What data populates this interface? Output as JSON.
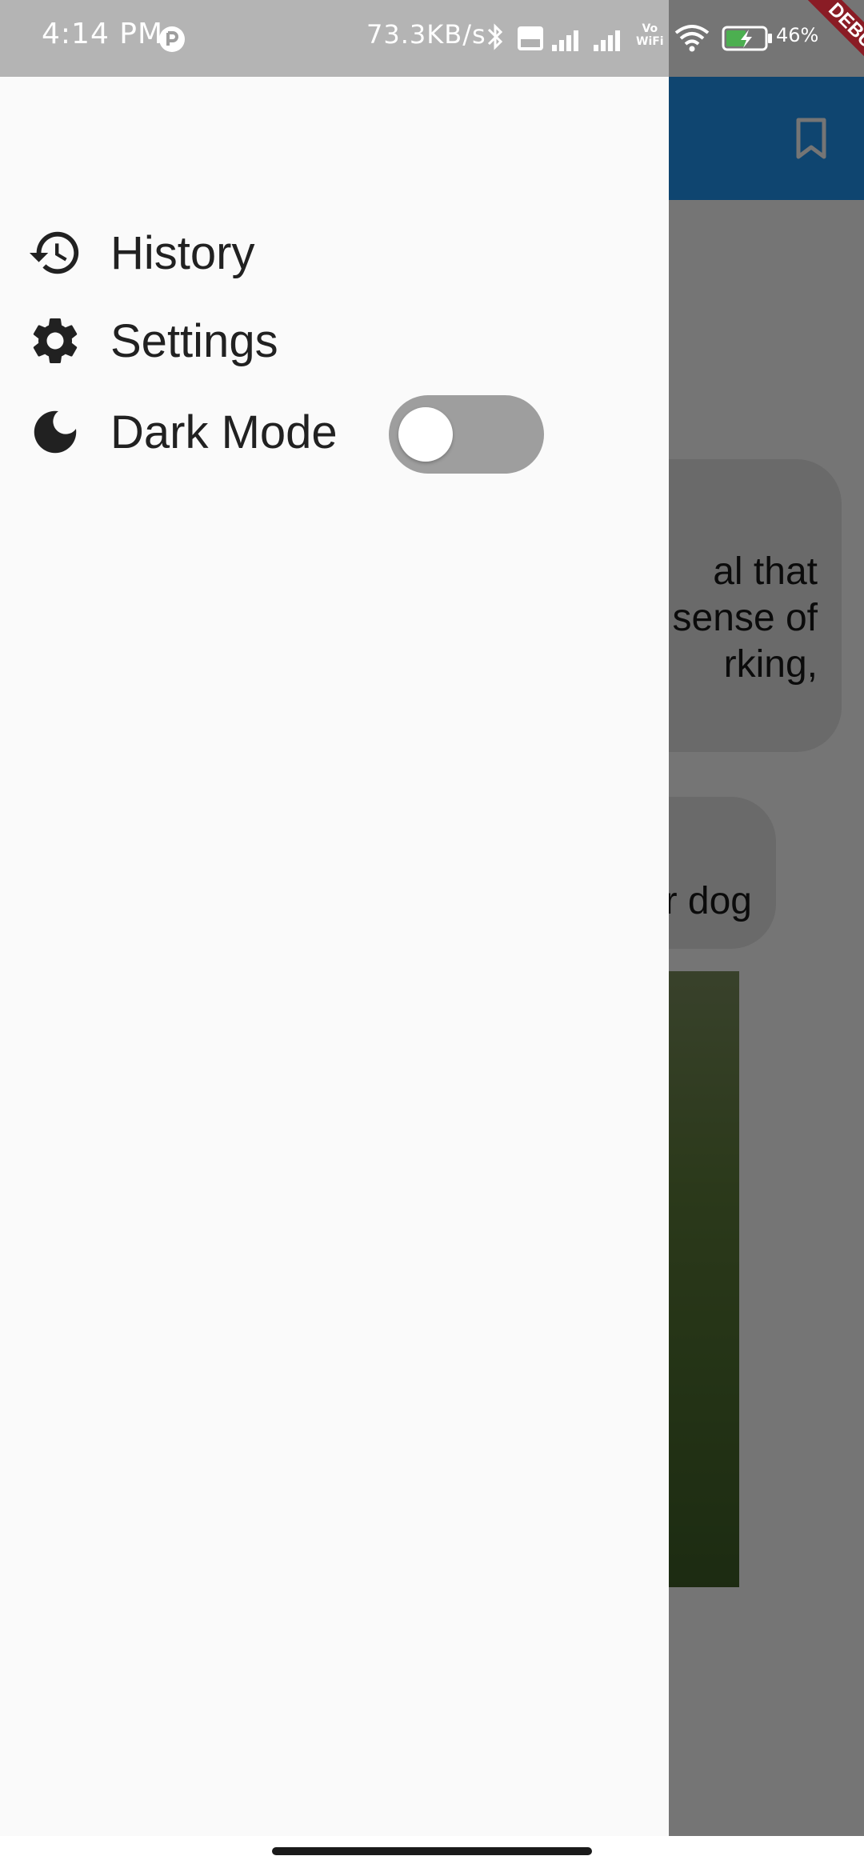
{
  "status_bar": {
    "time": "4:14 PM",
    "network_speed": "73.3KB/s",
    "vo_wifi_line1": "Vo",
    "vo_wifi_line2": "WiFi",
    "battery_percent": "46%",
    "icons": [
      "app-notification-icon",
      "bluetooth-icon",
      "volte-icon",
      "signal-icon",
      "signal-icon",
      "vowifi-icon",
      "wifi-icon",
      "battery-charging-icon"
    ]
  },
  "debug_banner": "DEBUG",
  "app_bar": {
    "color": "#2196f3",
    "actions": [
      "bookmark-icon"
    ]
  },
  "chat": {
    "bubble_1_lines": [
      "al that",
      "sense of",
      "rking,"
    ],
    "bubble_2_text": "r dog",
    "photo": "dog-photo"
  },
  "drawer": {
    "items": [
      {
        "label": "History",
        "icon": "history-icon"
      },
      {
        "label": "Settings",
        "icon": "gear-icon"
      },
      {
        "label": "Dark Mode",
        "icon": "moon-icon"
      }
    ],
    "dark_mode_enabled": false
  },
  "colors": {
    "drawer_bg": "#fafafa",
    "toggle_off": "#9e9e9e",
    "accent": "#2196f3"
  }
}
